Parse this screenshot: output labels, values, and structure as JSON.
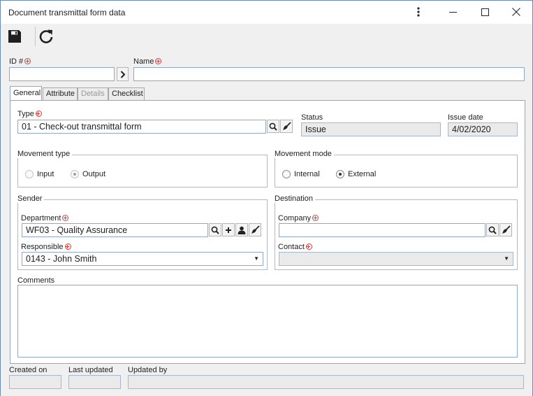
{
  "window": {
    "title": "Document transmittal form data",
    "menu_icon": "more-vertical-icon",
    "minimize_icon": "minimize-icon",
    "maximize_icon": "maximize-icon",
    "close_icon": "close-icon"
  },
  "toolbar": {
    "save_icon": "save-icon",
    "refresh_icon": "refresh-icon"
  },
  "header": {
    "id_label": "ID #",
    "id_value": "",
    "name_label": "Name",
    "name_value": ""
  },
  "tabs": [
    {
      "label": "General",
      "active": true
    },
    {
      "label": "Attribute",
      "active": false
    },
    {
      "label": "Details",
      "active": false,
      "disabled": true
    },
    {
      "label": "Checklist",
      "active": false
    }
  ],
  "general": {
    "type_label": "Type",
    "type_value": "01 - Check-out transmittal form",
    "status_label": "Status",
    "status_value": "Issue",
    "issue_date_label": "Issue date",
    "issue_date_value": "4/02/2020",
    "movement_type": {
      "title": "Movement type",
      "options": [
        {
          "label": "Input",
          "checked": false
        },
        {
          "label": "Output",
          "checked": true
        }
      ]
    },
    "movement_mode": {
      "title": "Movement mode",
      "options": [
        {
          "label": "Internal",
          "checked": false
        },
        {
          "label": "External",
          "checked": true
        }
      ]
    },
    "sender": {
      "title": "Sender",
      "department_label": "Department",
      "department_value": "WF03 - Quality Assurance",
      "responsible_label": "Responsible",
      "responsible_value": "0143 - John Smith"
    },
    "destination": {
      "title": "Destination",
      "company_label": "Company",
      "company_value": "",
      "contact_label": "Contact",
      "contact_value": ""
    },
    "comments_label": "Comments",
    "comments_value": ""
  },
  "footer": {
    "created_on_label": "Created on",
    "created_on_value": "",
    "last_updated_label": "Last updated",
    "last_updated_value": "",
    "updated_by_label": "Updated by",
    "updated_by_value": ""
  }
}
